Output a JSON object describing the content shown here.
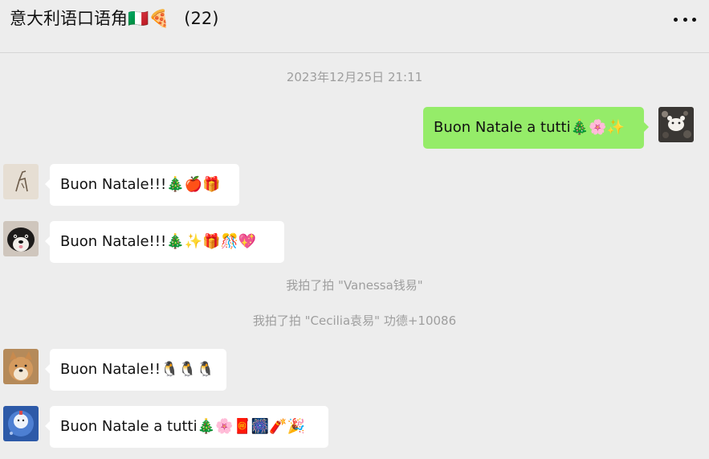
{
  "header": {
    "group_name": "意大利语口语角🇮🇹🍕",
    "member_count": "(22)",
    "more_icon": "more-dots-icon"
  },
  "timestamp": "2023年12月25日 21:11",
  "messages": [
    {
      "side": "right",
      "sender": "me",
      "text": "Buon Natale a tutti🎄🌸✨"
    },
    {
      "side": "left",
      "sender": "member-1",
      "text": "Buon Natale!!!🎄🍎🎁"
    },
    {
      "side": "left",
      "sender": "member-2",
      "text": "Buon Natale!!!🎄✨🎁🎊💖"
    },
    {
      "side": "left",
      "sender": "member-3",
      "text": "Buon Natale!!🐧🐧🐧"
    },
    {
      "side": "left",
      "sender": "member-4",
      "text": "Buon Natale a tutti🎄🌸🧧🎆🧨🎉"
    }
  ],
  "system_notices": [
    "我拍了拍 \"Vanessa钱易\"",
    "我拍了拍 \"Cecilia袁易\" 功德+10086"
  ],
  "colors": {
    "background": "#ededed",
    "outgoing_bubble": "#95ec69",
    "incoming_bubble": "#ffffff",
    "system_text": "#9e9e9e"
  }
}
